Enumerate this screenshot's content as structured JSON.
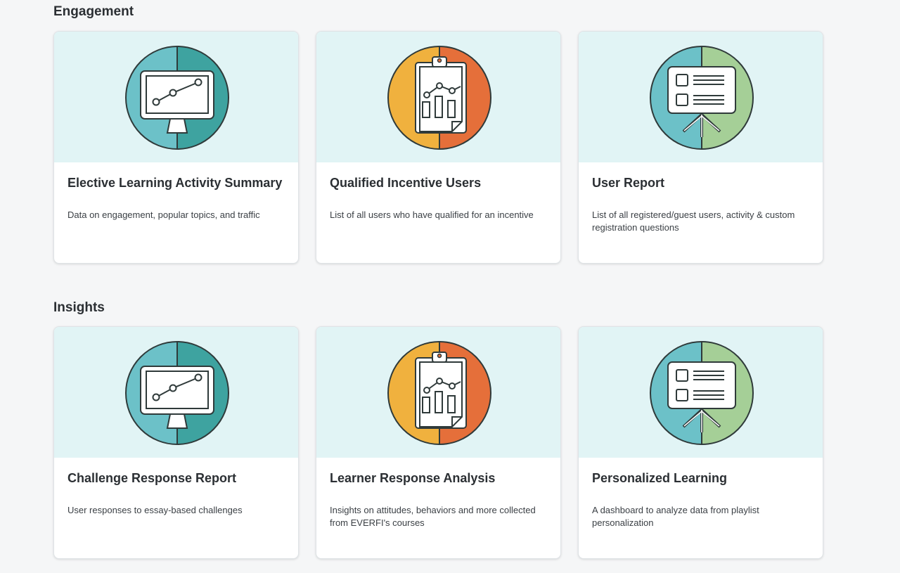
{
  "sections": [
    {
      "heading": "Engagement",
      "cards": [
        {
          "title": "Elective Learning Activity Summary",
          "description": "Data on engagement, popular topics, and traffic",
          "icon": "monitor-chart-icon"
        },
        {
          "title": "Qualified Incentive Users",
          "description": "List of all users who have qualified for an incentive",
          "icon": "clipboard-chart-icon"
        },
        {
          "title": "User Report",
          "description": "List of all registered/guest users, activity & custom registration questions",
          "icon": "presentation-board-icon"
        }
      ]
    },
    {
      "heading": "Insights",
      "cards": [
        {
          "title": "Challenge Response Report",
          "description": "User responses to essay-based challenges",
          "icon": "monitor-chart-icon"
        },
        {
          "title": "Learner Response Analysis",
          "description": "Insights on attitudes, behaviors and more collected from EVERFI's courses",
          "icon": "clipboard-chart-icon"
        },
        {
          "title": "Personalized Learning",
          "description": "A dashboard to analyze data from playlist personalization",
          "icon": "presentation-board-icon"
        }
      ]
    }
  ],
  "colors": {
    "page_bg": "#f5f6f7",
    "banner_bg": "#e1f4f5",
    "teal_light": "#6cc1c8",
    "teal_dark": "#3ea3a0",
    "orange_yellow": "#f0b13e",
    "orange_red": "#e56f3a",
    "green_light": "#a5cf97"
  }
}
